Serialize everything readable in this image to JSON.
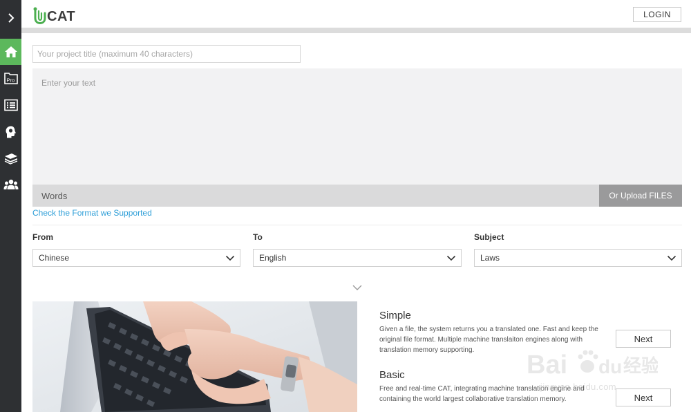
{
  "sidebar": {
    "toggle_icon": "chevron-right-icon",
    "items": [
      {
        "icon": "home-icon",
        "active": true
      },
      {
        "icon": "pro-icon",
        "label": "Pro"
      },
      {
        "icon": "list-icon"
      },
      {
        "icon": "head-bulb-icon"
      },
      {
        "icon": "books-icon"
      },
      {
        "icon": "users-icon"
      }
    ],
    "active_color": "#5cb85c"
  },
  "header": {
    "logo_text": "CAT",
    "logo_letter": "U",
    "login_label": "LOGIN"
  },
  "project": {
    "title_placeholder": "Your project title (maximum 40 characters)",
    "text_placeholder": "Enter your text",
    "words_label": "Words",
    "upload_label": "Or Upload FILES",
    "format_link": "Check the Format we Supported"
  },
  "fields": {
    "from": {
      "label": "From",
      "value": "Chinese"
    },
    "to": {
      "label": "To",
      "value": "English"
    },
    "subject": {
      "label": "Subject",
      "value": "Laws"
    }
  },
  "plans": [
    {
      "title": "Simple",
      "description": "Given a file, the system returns you a translated one. Fast and keep the original file format. Multiple machine translaiton engines along with translation memory supporting.",
      "button": "Next"
    },
    {
      "title": "Basic",
      "description": "Free and real-time CAT, integrating machine translation engine and containing the world largest collaborative translation memory.",
      "button": "Next"
    }
  ],
  "watermark": {
    "brand": "Bai du 经验",
    "url": "jingyan.baidu.com"
  },
  "colors": {
    "link": "#2f9fd8",
    "sidebar_bg": "#2e3033",
    "logo_green": "#4caf50"
  }
}
